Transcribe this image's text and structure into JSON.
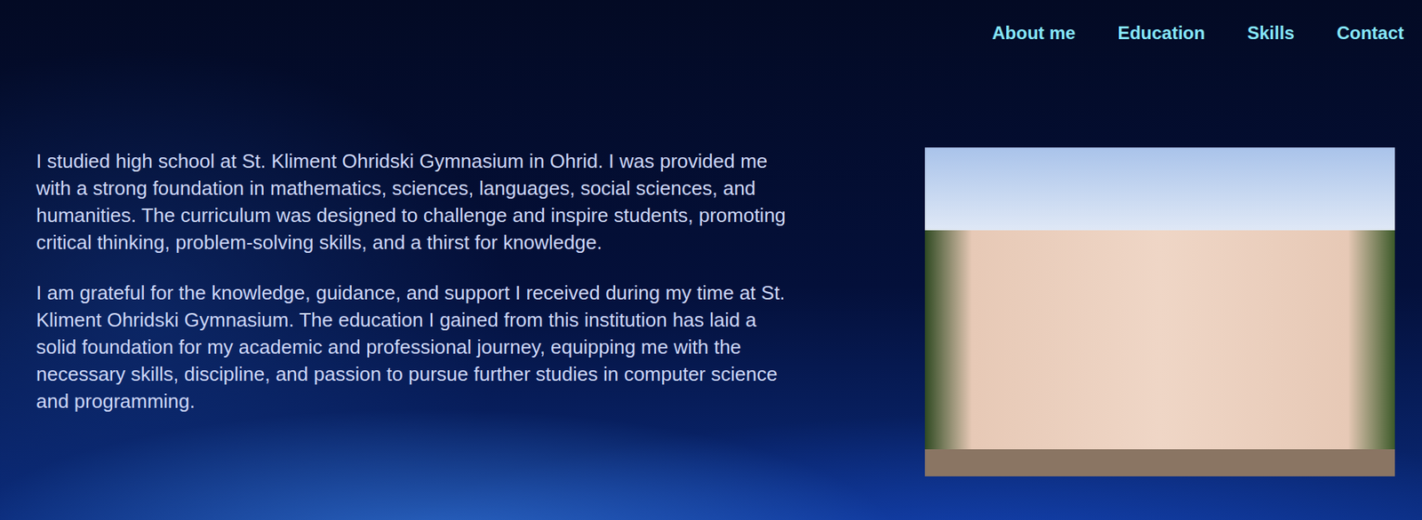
{
  "nav": {
    "items": [
      {
        "label": "About me"
      },
      {
        "label": "Education"
      },
      {
        "label": "Skills"
      },
      {
        "label": "Contact"
      }
    ]
  },
  "education": {
    "paragraphs": [
      "I studied high school at St. Kliment Ohridski Gymnasium in Ohrid. I was provided me with a strong foundation in mathematics, sciences, languages, social sciences, and humanities. The curriculum was designed to challenge and inspire students, promoting critical thinking, problem-solving skills, and a thirst for knowledge.",
      "I am grateful for the knowledge, guidance, and support I received during my time at St. Kliment Ohridski Gymnasium. The education I gained from this institution has laid a solid foundation for my academic and professional journey, equipping me with the necessary skills, discipline, and passion to pursue further studies in computer science and programming."
    ]
  }
}
